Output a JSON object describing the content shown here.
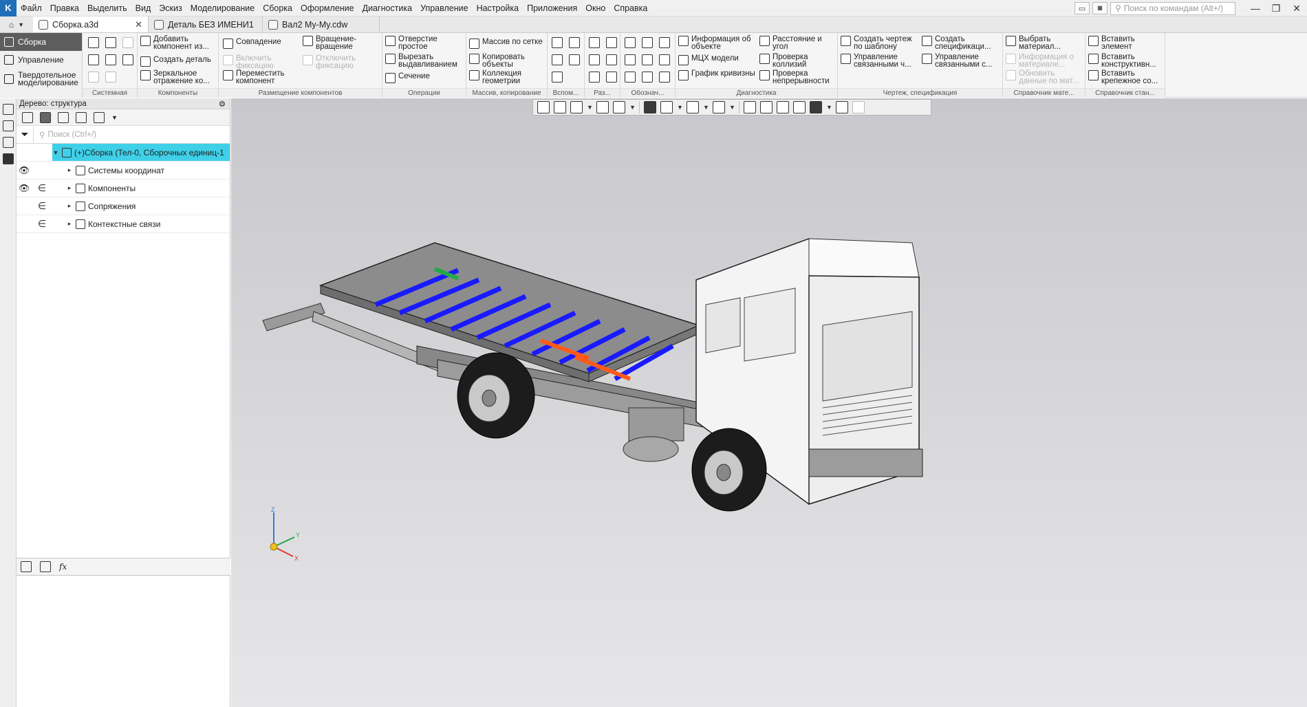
{
  "menu": [
    "Файл",
    "Правка",
    "Выделить",
    "Вид",
    "Эскиз",
    "Моделирование",
    "Сборка",
    "Оформление",
    "Диагностика",
    "Управление",
    "Настройка",
    "Приложения",
    "Окно",
    "Справка"
  ],
  "command_search": {
    "placeholder": "Поиск по командам (Alt+/)"
  },
  "tabs": [
    {
      "label": "Сборка.a3d",
      "active": true
    },
    {
      "label": "Деталь БЕЗ ИМЕНИ1",
      "active": false
    },
    {
      "label": "Вал2 My-My.cdw",
      "active": false
    }
  ],
  "ribbon_tabs": [
    "Сборка",
    "Управление",
    "Твердотельное моделирование"
  ],
  "ribbon_groups": {
    "system": "Системная",
    "components": "Компоненты",
    "placement": "Размещение компонентов",
    "operations": "Операции",
    "array": "Массив, копирование",
    "aux": "Вспом...",
    "sizes": "Раз...",
    "designations": "Обознач...",
    "diagnostics": "Диагностика",
    "drawing": "Чертеж, спецификация",
    "materials": "Справочник мате...",
    "standard": "Справочник стан..."
  },
  "ribbon_buttons": {
    "add_component": "Добавить компонент из...",
    "create_part": "Создать деталь",
    "mirror": "Зеркальное отражение ко...",
    "coincidence": "Совпадение",
    "enable_fix": "Включить фиксацию",
    "move_component": "Переместить компонент",
    "rotation": "Вращение-вращение",
    "disable_fix": "Отключить фиксацию",
    "simple_hole": "Отверстие простое",
    "cut_extrude": "Вырезать выдавливанием",
    "section": "Сечение",
    "grid_array": "Массив по сетке",
    "copy_objects": "Копировать объекты",
    "geometry_collection": "Коллекция геометрии",
    "object_info": "Информация об объекте",
    "mass_props": "МЦХ модели",
    "curvature_graph": "График кривизны",
    "distance_angle": "Расстояние и угол",
    "collision_check": "Проверка коллизий",
    "continuity_check": "Проверка непрерывности",
    "drawing_from_template": "Создать чертеж по шаблону",
    "manage_linked_drawings": "Управление связанными ч...",
    "create_spec": "Создать спецификаци...",
    "manage_linked_specs": "Управление связанными с...",
    "choose_material": "Выбрать материал...",
    "material_info": "Информация о материале...",
    "update_material": "Обновить данные по мат...",
    "insert_element": "Вставить элемент",
    "insert_structural": "Вставить конструктивн...",
    "insert_fastener": "Вставить крепежное со..."
  },
  "tree_panel": {
    "title": "Дерево: структура",
    "search_placeholder": "Поиск (Ctrl+/)",
    "rows": [
      {
        "label": "(+)Сборка (Тел-0, Сборочных единиц-1",
        "selected": true
      },
      {
        "label": "Системы координат"
      },
      {
        "label": "Компоненты"
      },
      {
        "label": "Сопряжения"
      },
      {
        "label": "Контекстные связи"
      }
    ]
  },
  "axes": {
    "z": "Z",
    "y": "Y",
    "x": "X"
  },
  "colors": {
    "accent": "#3fd0e8",
    "frame_blue": "#1a1aff",
    "frame_orange": "#ff5a1a",
    "frame_green": "#22aa44"
  }
}
